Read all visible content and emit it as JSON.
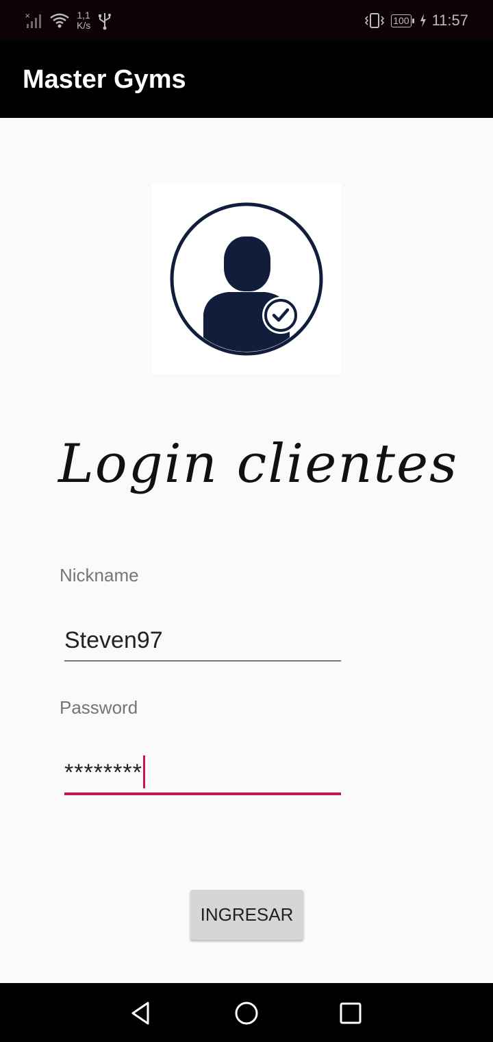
{
  "status_bar": {
    "net_speed_value": "1,1",
    "net_speed_unit": "K/s",
    "battery": "100",
    "time": "11:57"
  },
  "app_bar": {
    "title": "Master Gyms"
  },
  "login": {
    "heading": "Login clientes",
    "nickname_label": "Nickname",
    "nickname_value": "Steven97",
    "password_label": "Password",
    "password_value": "********",
    "submit_label": "INGRESAR"
  },
  "colors": {
    "accent": "#c2185b",
    "app_bar": "#000000",
    "avatar_navy": "#101e3c"
  },
  "icons": {
    "avatar": "user-check-icon",
    "nav_back": "back-triangle-icon",
    "nav_home": "home-circle-icon",
    "nav_recents": "recents-square-icon"
  }
}
